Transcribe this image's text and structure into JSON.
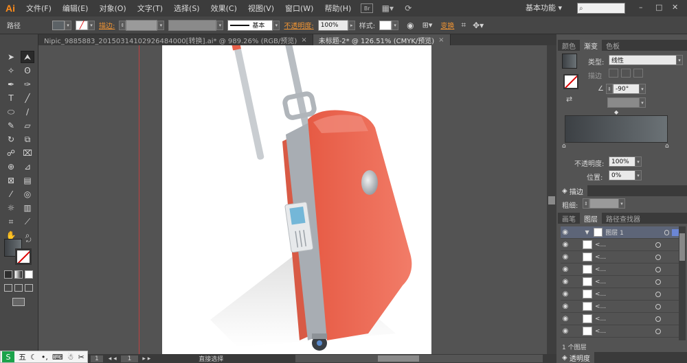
{
  "app": {
    "logo": "Ai",
    "workspace": "基本功能"
  },
  "menubar": [
    "文件(F)",
    "编辑(E)",
    "对象(O)",
    "文字(T)",
    "选择(S)",
    "效果(C)",
    "视图(V)",
    "窗口(W)",
    "帮助(H)"
  ],
  "menubar_icons": {
    "bridge": "Br",
    "arrange": "arrange-docs-icon",
    "gpu": "gpu-icon"
  },
  "window": {
    "minimize": "–",
    "restore": "□",
    "close": "✕"
  },
  "control": {
    "object_type": "路径",
    "stroke_label": "描边:",
    "stroke_style": "基本",
    "opacity_label": "不透明度:",
    "opacity_value": "100%",
    "style_label": "样式:",
    "transform_label": "变换"
  },
  "doc_tabs": [
    {
      "label": "Nipic_9885883_20150314102926484000[转换].ai* @ 989.26% (RGB/预览)",
      "close": "×"
    },
    {
      "label": "未标题-2* @ 126.51% (CMYK/预览)",
      "close": "×"
    }
  ],
  "gradient_panel": {
    "tabs": [
      "颜色",
      "渐变",
      "色板"
    ],
    "type_label": "类型:",
    "type_value": "线性",
    "stroke_label": "描边",
    "angle_value": "-90°",
    "opacity_label": "不透明度:",
    "opacity_value": "100%",
    "location_label": "位置:",
    "location_value": "0%",
    "colors": {
      "start": "#3c4044",
      "end": "#6b7276"
    }
  },
  "stroke_panel": {
    "title": "描边",
    "weight_label": "粗细:"
  },
  "layers_panel": {
    "tabs": [
      "画笔",
      "图层",
      "路径查找器"
    ],
    "layer_name": "图层 1",
    "sublayers": [
      "<...",
      "<...",
      "<...",
      "<...",
      "<...",
      "<...",
      "<...",
      "<..."
    ],
    "footer": "1 个图层"
  },
  "transparency_panel": {
    "title": "透明度"
  },
  "statusbar": {
    "zoom": "1",
    "page": "1",
    "tool": "直接选择"
  },
  "ime": {
    "label": "五"
  },
  "artwork": {
    "suitcase_color": "#e8604a",
    "highlight": "#f08878",
    "frame": "#a8adb3"
  }
}
